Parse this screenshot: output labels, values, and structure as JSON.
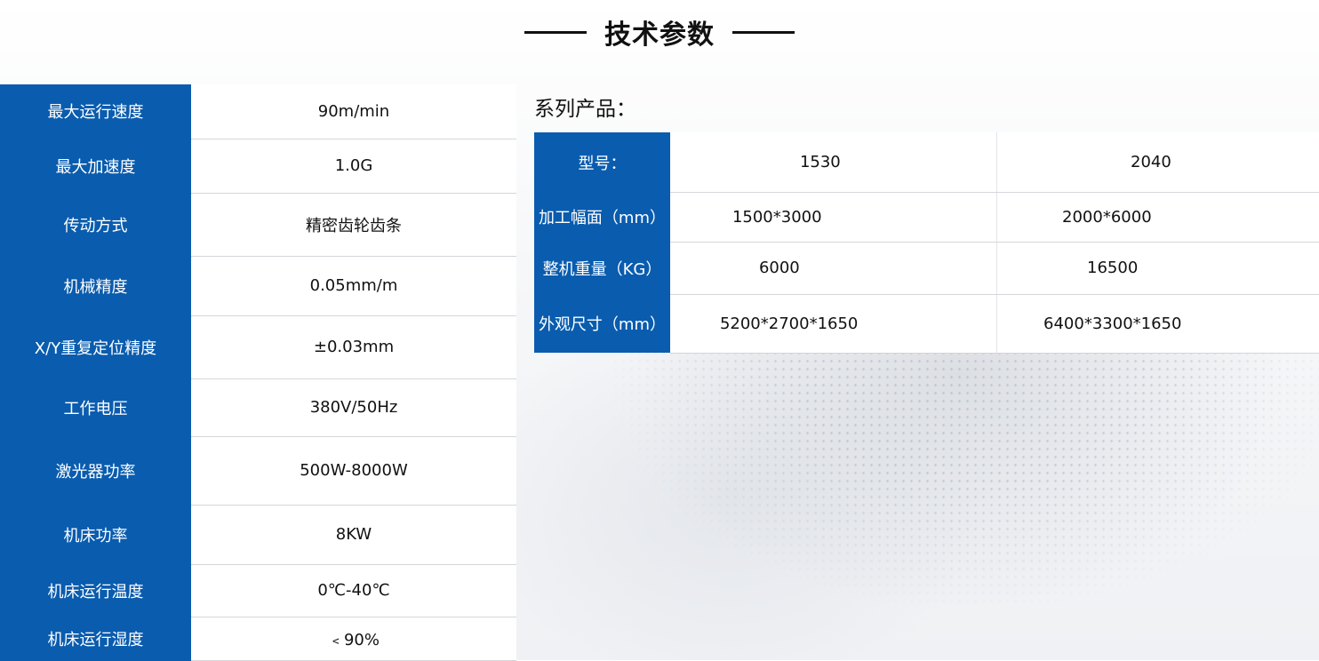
{
  "heading": {
    "title": "技术参数"
  },
  "specs": [
    {
      "label": "最大运行速度",
      "value": "90m/min"
    },
    {
      "label": "最大加速度",
      "value": "1.0G"
    },
    {
      "label": "传动方式",
      "value": "精密齿轮齿条"
    },
    {
      "label": "机械精度",
      "value": "0.05mm/m"
    },
    {
      "label": "X/Y重复定位精度",
      "value": "±0.03mm"
    },
    {
      "label": "工作电压",
      "value": "380V/50Hz"
    },
    {
      "label": "激光器功率",
      "value": "500W-8000W"
    },
    {
      "label": "机床功率",
      "value": "8KW"
    },
    {
      "label": "机床运行温度",
      "value": "0℃-40℃"
    },
    {
      "label": "机床运行湿度",
      "value": "﹤90%"
    }
  ],
  "series": {
    "label": "系列产品：",
    "rows": [
      {
        "label": "型号：",
        "values": [
          "1530",
          "2040"
        ]
      },
      {
        "label": "加工幅面（mm）",
        "values": [
          "1500*3000",
          "2000*6000"
        ]
      },
      {
        "label": "整机重量（KG）",
        "values": [
          "6000",
          "16500"
        ]
      },
      {
        "label": "外观尺寸（mm）",
        "values": [
          "5200*2700*1650",
          "6400*3300*1650"
        ]
      }
    ]
  },
  "colors": {
    "accent": "#0a5cae",
    "text": "#111111",
    "divider": "#d4d6da"
  }
}
